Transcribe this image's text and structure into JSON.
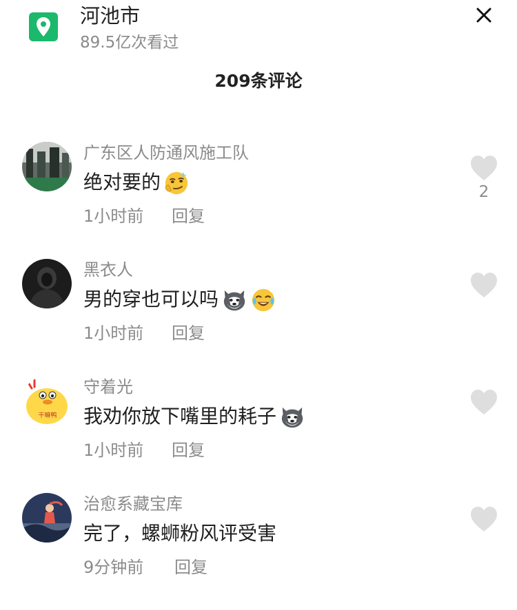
{
  "header": {
    "location_name": "河池市",
    "views": "89.5亿次看过",
    "close_icon": "close-icon",
    "location_icon": "map-pin-icon",
    "accent_color": "#1cb86b"
  },
  "comment_count": "209条评论",
  "comments": [
    {
      "user": "广东区人防通风施工队",
      "text": "绝对要的",
      "emojis": [
        "smirk-emoji"
      ],
      "time": "1小时前",
      "reply": "回复",
      "likes": "2"
    },
    {
      "user": "黑衣人",
      "text": "男的穿也可以吗",
      "emojis": [
        "husky-emoji",
        "crying-laughing-emoji"
      ],
      "time": "1小时前",
      "reply": "回复",
      "likes": ""
    },
    {
      "user": "守着光",
      "text": "我劝你放下嘴里的耗子",
      "emojis": [
        "husky-emoji"
      ],
      "time": "1小时前",
      "reply": "回复",
      "likes": ""
    },
    {
      "user": "治愈系藏宝库",
      "text": "完了，螺蛳粉风评受害",
      "emojis": [],
      "time": "9分钟前",
      "reply": "回复",
      "likes": ""
    }
  ]
}
